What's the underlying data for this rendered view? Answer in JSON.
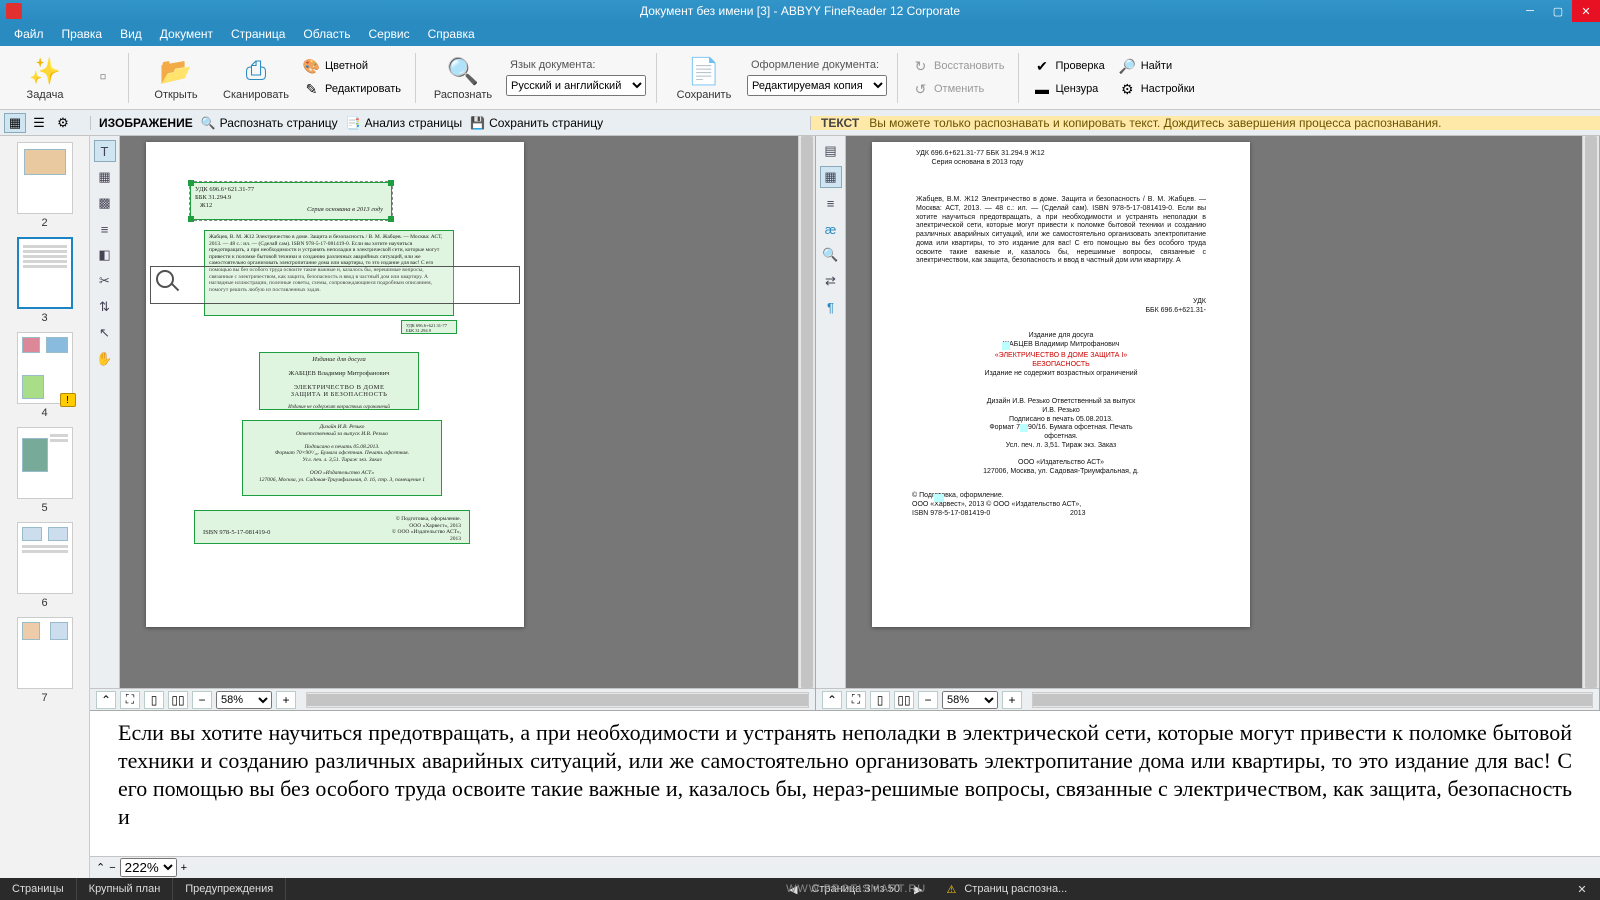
{
  "app": {
    "title": "Документ без имени [3] - ABBYY FineReader 12 Corporate"
  },
  "menubar": [
    "Файл",
    "Правка",
    "Вид",
    "Документ",
    "Страница",
    "Область",
    "Сервис",
    "Справка"
  ],
  "ribbon": {
    "task": "Задача",
    "open": "Открыть",
    "scan": "Сканировать",
    "color": "Цветной",
    "edit": "Редактировать",
    "recognize": "Распознать",
    "lang_label": "Язык документа:",
    "lang_value": "Русский и английский",
    "save": "Сохранить",
    "layout_label": "Оформление документа:",
    "layout_value": "Редактируемая копия",
    "restore": "Восстановить",
    "undo": "Отменить",
    "check": "Проверка",
    "censor": "Цензура",
    "find": "Найти",
    "settings": "Настройки"
  },
  "subtool": {
    "image_label": "ИЗОБРАЖЕНИЕ",
    "recog_page": "Распознать страницу",
    "analyze_page": "Анализ страницы",
    "save_page": "Сохранить страницу",
    "text_label": "ТЕКСТ",
    "text_msg": "Вы можете только распознавать и копировать текст. Дождитесь завершения процесса распознавания."
  },
  "thumbs": [
    {
      "num": "2",
      "warn": false,
      "sel": false
    },
    {
      "num": "3",
      "warn": false,
      "sel": true
    },
    {
      "num": "4",
      "warn": true,
      "sel": false
    },
    {
      "num": "5",
      "warn": false,
      "sel": false
    },
    {
      "num": "6",
      "warn": false,
      "sel": false
    },
    {
      "num": "7",
      "warn": false,
      "sel": false
    }
  ],
  "zoom": {
    "left": "58%",
    "right": "58%",
    "closeup": "222%"
  },
  "image_zones": {
    "z1_a": "УДК 696.6+621.31-77\nББК 31.294.9\n   Ж12",
    "z1_b": "Серия основана в 2013 году",
    "z2": "Жабцев, В. М.\nЖ12   Электричество в доме. Защита и безопасность / В. М. Жабцев. — Москва: АСТ, 2013. — 48 с.: ил. — (Сделай сам).\n   ISBN 978-5-17-081419-0.\n   Если вы хотите научиться предотвращать, а при необходимости и устранять неполадки в электрической сети, которые могут привести к поломке бытовой техники и созданию различных аварийных ситуаций, или же самостоятельно организовать электропитание дома или квартиры, то это издание для вас! С его помощью вы без особого труда освоите такие важные и, казалось бы, нерешимые вопросы, связанные с электричеством, как защита, безопасность и ввод в частный дом или квартиру. А наглядные иллюстрации, полезные советы, схемы, сопровождающиеся подробным описанием, помогут решить любую из поставленных задач.",
    "z2_small": "УДК 696.6+621.31-77\nББК 31.294.9",
    "z3_a": "Издание для досуга",
    "z3_b": "ЖАБЦЕВ Владимир Митрофанович",
    "z3_c": "ЭЛЕКТРИЧЕСТВО В ДОМЕ\nЗАЩИТА И БЕЗОПАСНОСТЬ",
    "z3_d": "Издание не содержит возрастных ограничений",
    "z4": "Дизайн И.В. Резько\nОтветственный за выпуск И.В. Резько\n\nПодписано в печать 05.08.2013.\nФормат 70×90¹/₁₆. Бумага офсетная. Печать офсетная.\nУсл. печ. л. 3,51. Тираж     экз. Заказ\n\nООО «Издательство АСТ»\n127006, Москва, ул. Садовая-Триумфальная, д. 16, стр. 3, помещение 1",
    "z5_a": "ISBN 978-5-17-081419-0",
    "z5_b": "© Подготовка, оформление.\n   ООО «Харвест», 2013\n© ООО «Издательство АСТ»,\n   2013"
  },
  "text_pane": {
    "t1": "УДК 696.6+621.31-77 ББК 31.294.9 Ж12\n        Серия основана в 2013 году",
    "t2": "Жабцев, В.М.\nЖ12 Электричество в доме. Защита и безопасность / В. М. Жабцев. — Москва: АСТ, 2013. — 48 с.: ил. — (Сделай сам).\nISBN 978-5-17-081419-0.\nЕсли вы хотите научиться предотвращать, а при необходимости и устранять неполадки в электрической сети, которые могут привести к поломке бытовой техники и созданию различных аварийных ситуаций, или же самостоятельно организовать электропитание дома или квартиры, то это издание для вас! С его помощью вы без особого труда освоите такие важные и, казалось бы, нерешимые вопросы, связанные с электричеством, как защита, безопасность и ввод в частный дом или квартиру. А",
    "t2b": "УДК\nББК 696.6+621.31-",
    "t3": "Издание для досуга\nЖАБЦЕВ Владимир Митрофанович",
    "t3r": "«ЭЛЕКТРИЧЕСТВО В ДОМЕ ЗАЩИТА I»\nБЕЗОПАСНОСТЬ",
    "t3c": "Издание не содержит возрастных ограничений",
    "t4": "Дизайн И.В. Резько Ответственный за выпуск\nИ.В. Резько\nПодписано в печать 05.08.2013.\nФормат 70×90/16. Бумага офсетная. Печать\nофсетная.\nУсл. печ. л. 3,51. Тираж экз. Заказ\n\nООО «Издательство АСТ»\n127006, Москва, ул. Садовая-Триумфальная, д.",
    "t5": "© Подготовка, оформление.\nООО «Харвест», 2013 © ООО «Издательство АСТ»,\nISBN 978-5-17-081419-0                                         2013"
  },
  "closeup_text": "Если вы хотите научиться предотвращать, а при необходимости и устранять неполадки в электрической сети, которые могут привести к поломке бытовой техники и созданию различных аварийных ситуаций, или же самостоятельно организовать электропитание дома или квартиры, то это издание для вас! С его помощью вы без особого труда освоите такие важные и, казалось бы, нераз-решимые вопросы, связанные с электричеством, как защита, безопасность и",
  "status": {
    "tabs": [
      "Страницы",
      "Крупный план",
      "Предупреждения"
    ],
    "page_nav": "Страница 3 из 50",
    "warn_msg": "Страниц распозна...",
    "watermark": "WWW.PROFISMART.RU"
  }
}
